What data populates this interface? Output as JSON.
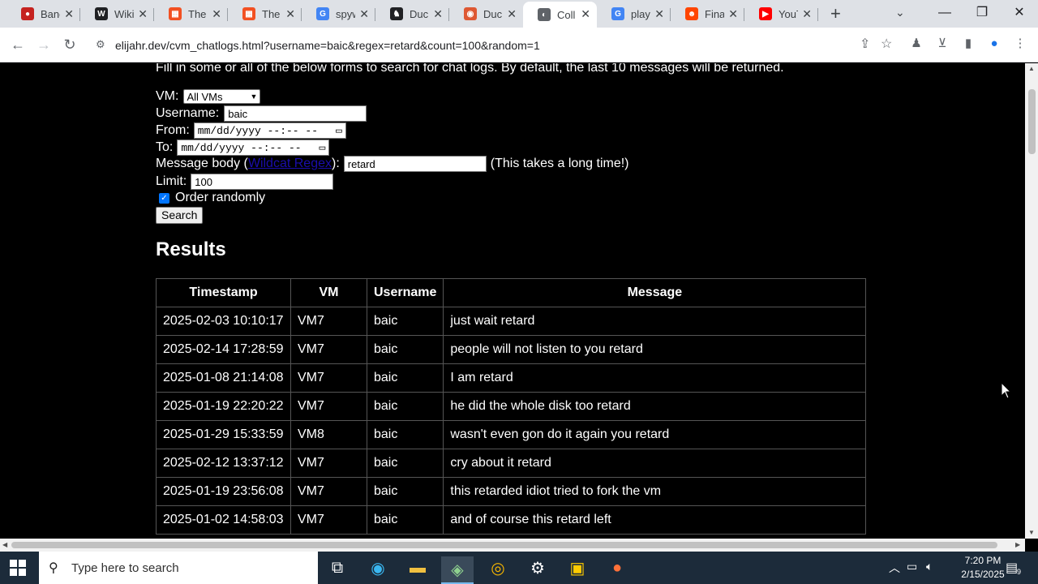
{
  "browser": {
    "tabs": [
      {
        "title": "Band",
        "fav_color": "#c5221f",
        "fav_glyph": "●"
      },
      {
        "title": "Wiki",
        "fav_color": "#202124",
        "fav_glyph": "W"
      },
      {
        "title": "The",
        "fav_color": "#f25022",
        "fav_glyph": "▦"
      },
      {
        "title": "The",
        "fav_color": "#f25022",
        "fav_glyph": "▦"
      },
      {
        "title": "spyw",
        "fav_color": "#4285f4",
        "fav_glyph": "G"
      },
      {
        "title": "Duck",
        "fav_color": "#202124",
        "fav_glyph": "♞"
      },
      {
        "title": "Duck",
        "fav_color": "#de5833",
        "fav_glyph": "◉"
      },
      {
        "title": "Coll",
        "fav_color": "#5f6368",
        "fav_glyph": "◐"
      },
      {
        "title": "play",
        "fav_color": "#4285f4",
        "fav_glyph": "G"
      },
      {
        "title": "Fina",
        "fav_color": "#ff4500",
        "fav_glyph": "☻"
      },
      {
        "title": "YouT",
        "fav_color": "#ff0000",
        "fav_glyph": "▶"
      }
    ],
    "url": "elijahr.dev/cvm_chatlogs.html?username=baic&regex=retard&count=100&random=1"
  },
  "form": {
    "intro": "Fill in some or all of the below forms to search for chat logs. By default, the last 10 messages will be returned.",
    "vm_label": "VM:",
    "vm_value": "All VMs",
    "username_label": "Username:",
    "username_value": "baic",
    "from_label": "From:",
    "from_placeholder": "mm/dd/yyyy --:-- --",
    "to_label": "To:",
    "to_placeholder": "mm/dd/yyyy --:-- --",
    "message_label_pre": "Message body (",
    "message_link": "Wildcat Regex",
    "message_label_post": "):",
    "message_value": "retard",
    "message_note": "(This takes a long time!)",
    "limit_label": "Limit:",
    "limit_value": "100",
    "random_label": "Order randomly",
    "search_button": "Search"
  },
  "results": {
    "heading": "Results",
    "columns": [
      "Timestamp",
      "VM",
      "Username",
      "Message"
    ],
    "rows": [
      [
        "2025-02-03 10:10:17",
        "VM7",
        "baic",
        "just wait retard"
      ],
      [
        "2025-02-14 17:28:59",
        "VM7",
        "baic",
        "people will not listen to you retard"
      ],
      [
        "2025-01-08 21:14:08",
        "VM7",
        "baic",
        "I am retard"
      ],
      [
        "2025-01-19 22:20:22",
        "VM7",
        "baic",
        "he did the whole disk too retard"
      ],
      [
        "2025-01-29 15:33:59",
        "VM8",
        "baic",
        "wasn't even gon do it again you retard"
      ],
      [
        "2025-02-12 13:37:12",
        "VM7",
        "baic",
        "cry about it retard"
      ],
      [
        "2025-01-19 23:56:08",
        "VM7",
        "baic",
        "this retarded idiot tried to fork the vm"
      ],
      [
        "2025-01-02 14:58:03",
        "VM7",
        "baic",
        "and of course this retard left"
      ]
    ]
  },
  "taskbar": {
    "search_placeholder": "Type here to search",
    "time": "7:20 PM",
    "date": "2/15/2025",
    "notification_count": "9"
  }
}
